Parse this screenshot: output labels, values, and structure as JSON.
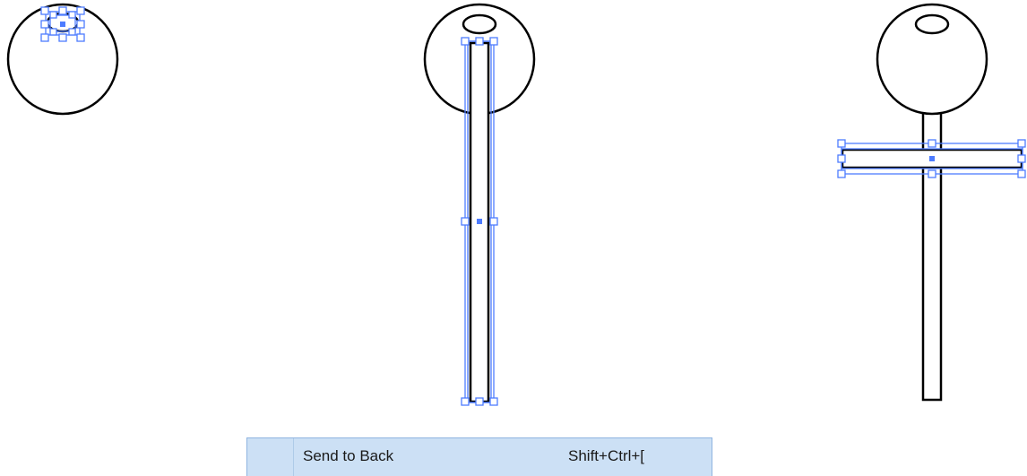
{
  "context_menu": {
    "item_label": "Send to Back",
    "item_shortcut": "Shift+Ctrl+["
  },
  "colors": {
    "selection": "#4d7cff",
    "stroke": "#000000",
    "menu_highlight": "#cce0f5"
  }
}
